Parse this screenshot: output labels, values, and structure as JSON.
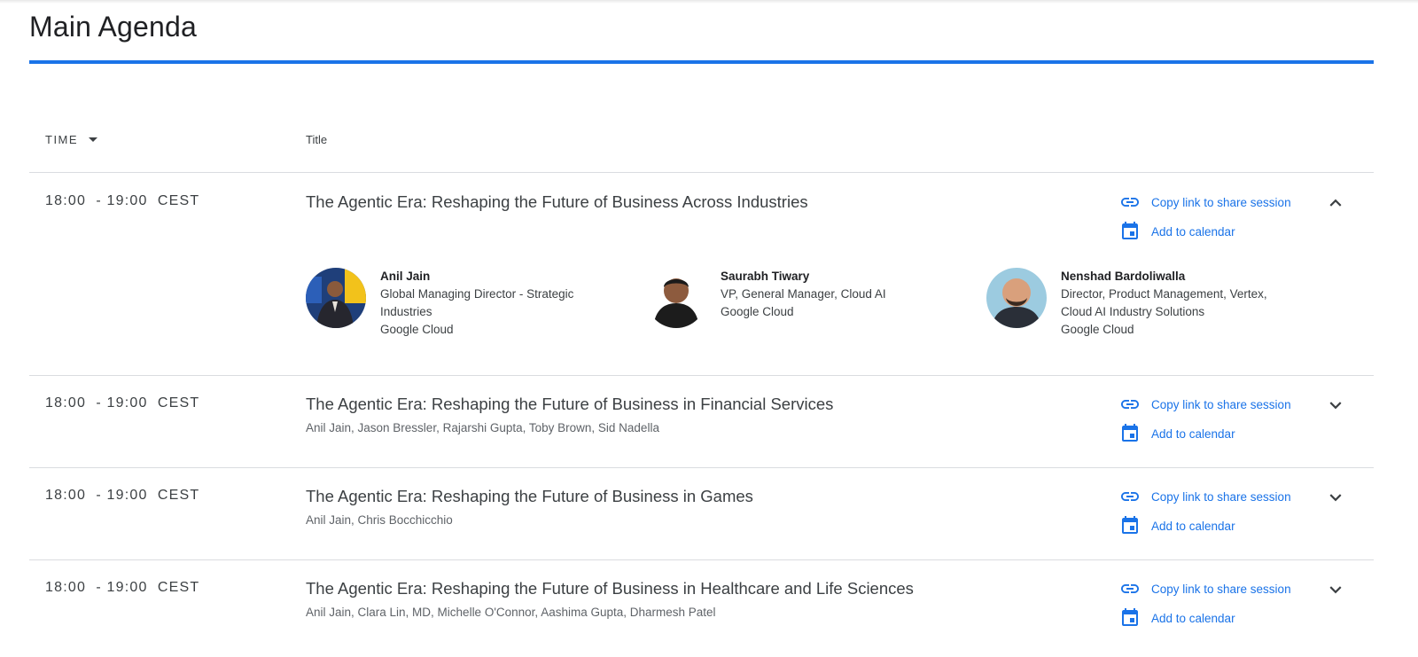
{
  "page": {
    "title": "Main Agenda"
  },
  "table": {
    "time_header": "TIME",
    "title_header": "Title"
  },
  "common": {
    "copy_link": "Copy link to share session",
    "add_calendar": "Add to calendar"
  },
  "sessions": [
    {
      "time": "18:00  - 19:00  CEST",
      "title": "The Agentic Era: Reshaping the Future of Business Across Industries",
      "expanded": true,
      "speakers": [
        {
          "name": "Anil Jain",
          "role_line1": "Global Managing Director - Strategic",
          "role_line2": "Industries",
          "company": "Google Cloud"
        },
        {
          "name": "Saurabh Tiwary",
          "role_line1": "VP, General Manager, Cloud AI",
          "company": "Google Cloud"
        },
        {
          "name": "Nenshad Bardoliwalla",
          "role_line1": "Director, Product Management, Vertex,",
          "role_line2": "Cloud AI Industry Solutions",
          "company": "Google Cloud"
        }
      ]
    },
    {
      "time": "18:00  - 19:00  CEST",
      "title": "The Agentic Era: Reshaping the Future of Business in Financial Services",
      "speakers_text": "Anil Jain, Jason Bressler, Rajarshi Gupta, Toby Brown, Sid Nadella",
      "expanded": false
    },
    {
      "time": "18:00  - 19:00  CEST",
      "title": "The Agentic Era: Reshaping the Future of Business in Games",
      "speakers_text": "Anil Jain, Chris Bocchicchio",
      "expanded": false
    },
    {
      "time": "18:00  - 19:00  CEST",
      "title": "The Agentic Era: Reshaping the Future of Business in Healthcare and Life Sciences",
      "speakers_text": "Anil Jain, Clara Lin, MD, Michelle O'Connor, Aashima Gupta, Dharmesh Patel",
      "expanded": false
    }
  ],
  "colors": {
    "accent": "#1a73e8",
    "text": "#3c4043",
    "divider": "#dadce0"
  },
  "icons": {
    "link": "link-icon",
    "calendar": "calendar-icon",
    "expand": "chevron-down-icon",
    "collapse": "chevron-up-icon",
    "sort": "sort-down-icon"
  }
}
